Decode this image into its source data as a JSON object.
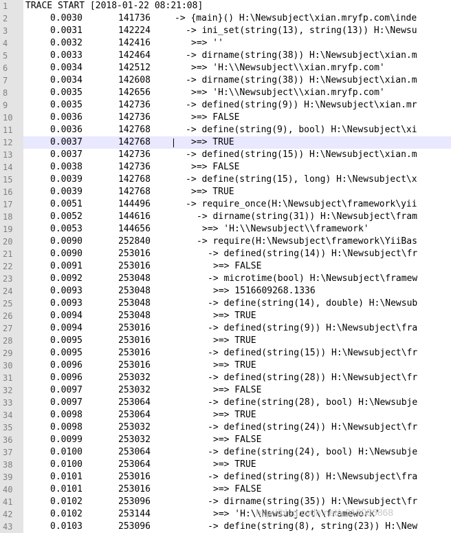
{
  "editor": {
    "lines": [
      {
        "n": "1",
        "full": "TRACE START [2018-01-22 08:21:08]"
      },
      {
        "n": "2",
        "t": "0.0030",
        "m": "141736",
        "c": "-> {main}() H:\\Newsubject\\xian.mryfp.com\\inde",
        "i": 0
      },
      {
        "n": "3",
        "t": "0.0031",
        "m": "142224",
        "c": "-> ini_set(string(13), string(13)) H:\\Newsu",
        "i": 2
      },
      {
        "n": "4",
        "t": "0.0032",
        "m": "142416",
        "c": ">=> ''",
        "i": 3
      },
      {
        "n": "5",
        "t": "0.0033",
        "m": "142464",
        "c": "-> dirname(string(38)) H:\\Newsubject\\xian.m",
        "i": 2
      },
      {
        "n": "6",
        "t": "0.0034",
        "m": "142512",
        "c": ">=> 'H:\\\\Newsubject\\\\xian.mryfp.com'",
        "i": 3
      },
      {
        "n": "7",
        "t": "0.0034",
        "m": "142608",
        "c": "-> dirname(string(38)) H:\\Newsubject\\xian.m",
        "i": 2
      },
      {
        "n": "8",
        "t": "0.0035",
        "m": "142656",
        "c": ">=> 'H:\\\\Newsubject\\\\xian.mryfp.com'",
        "i": 3
      },
      {
        "n": "9",
        "t": "0.0035",
        "m": "142736",
        "c": "-> defined(string(9)) H:\\Newsubject\\xian.mr",
        "i": 2
      },
      {
        "n": "10",
        "t": "0.0036",
        "m": "142736",
        "c": ">=> FALSE",
        "i": 3
      },
      {
        "n": "11",
        "t": "0.0036",
        "m": "142768",
        "c": "-> define(string(9), bool) H:\\Newsubject\\xi",
        "i": 2
      },
      {
        "n": "12",
        "t": "0.0037",
        "m": "142768",
        "c": ">=> TRUE",
        "i": 3,
        "current": true
      },
      {
        "n": "13",
        "t": "0.0037",
        "m": "142736",
        "c": "-> defined(string(15)) H:\\Newsubject\\xian.m",
        "i": 2
      },
      {
        "n": "14",
        "t": "0.0038",
        "m": "142736",
        "c": ">=> FALSE",
        "i": 3
      },
      {
        "n": "15",
        "t": "0.0039",
        "m": "142768",
        "c": "-> define(string(15), long) H:\\Newsubject\\x",
        "i": 2
      },
      {
        "n": "16",
        "t": "0.0039",
        "m": "142768",
        "c": ">=> TRUE",
        "i": 3
      },
      {
        "n": "17",
        "t": "0.0051",
        "m": "144496",
        "c": "-> require_once(H:\\Newsubject\\framework\\yii",
        "i": 2
      },
      {
        "n": "18",
        "t": "0.0052",
        "m": "144616",
        "c": "-> dirname(string(31)) H:\\Newsubject\\fram",
        "i": 4
      },
      {
        "n": "19",
        "t": "0.0053",
        "m": "144656",
        "c": ">=> 'H:\\\\Newsubject\\\\framework'",
        "i": 5
      },
      {
        "n": "20",
        "t": "0.0090",
        "m": "252840",
        "c": "-> require(H:\\Newsubject\\framework\\YiiBas",
        "i": 4
      },
      {
        "n": "21",
        "t": "0.0090",
        "m": "253016",
        "c": "-> defined(string(14)) H:\\Newsubject\\fr",
        "i": 6
      },
      {
        "n": "22",
        "t": "0.0091",
        "m": "253016",
        "c": ">=> FALSE",
        "i": 7
      },
      {
        "n": "23",
        "t": "0.0092",
        "m": "253048",
        "c": "-> microtime(bool) H:\\Newsubject\\framew",
        "i": 6
      },
      {
        "n": "24",
        "t": "0.0093",
        "m": "253048",
        "c": ">=> 1516609268.1336",
        "i": 7
      },
      {
        "n": "25",
        "t": "0.0093",
        "m": "253048",
        "c": "-> define(string(14), double) H:\\Newsub",
        "i": 6
      },
      {
        "n": "26",
        "t": "0.0094",
        "m": "253048",
        "c": ">=> TRUE",
        "i": 7
      },
      {
        "n": "27",
        "t": "0.0094",
        "m": "253016",
        "c": "-> defined(string(9)) H:\\Newsubject\\fra",
        "i": 6
      },
      {
        "n": "28",
        "t": "0.0095",
        "m": "253016",
        "c": ">=> TRUE",
        "i": 7
      },
      {
        "n": "29",
        "t": "0.0095",
        "m": "253016",
        "c": "-> defined(string(15)) H:\\Newsubject\\fr",
        "i": 6
      },
      {
        "n": "30",
        "t": "0.0096",
        "m": "253016",
        "c": ">=> TRUE",
        "i": 7
      },
      {
        "n": "31",
        "t": "0.0096",
        "m": "253032",
        "c": "-> defined(string(28)) H:\\Newsubject\\fr",
        "i": 6
      },
      {
        "n": "32",
        "t": "0.0097",
        "m": "253032",
        "c": ">=> FALSE",
        "i": 7
      },
      {
        "n": "33",
        "t": "0.0097",
        "m": "253064",
        "c": "-> define(string(28), bool) H:\\Newsubje",
        "i": 6
      },
      {
        "n": "34",
        "t": "0.0098",
        "m": "253064",
        "c": ">=> TRUE",
        "i": 7
      },
      {
        "n": "35",
        "t": "0.0098",
        "m": "253032",
        "c": "-> defined(string(24)) H:\\Newsubject\\fr",
        "i": 6
      },
      {
        "n": "36",
        "t": "0.0099",
        "m": "253032",
        "c": ">=> FALSE",
        "i": 7
      },
      {
        "n": "37",
        "t": "0.0100",
        "m": "253064",
        "c": "-> define(string(24), bool) H:\\Newsubje",
        "i": 6
      },
      {
        "n": "38",
        "t": "0.0100",
        "m": "253064",
        "c": ">=> TRUE",
        "i": 7
      },
      {
        "n": "39",
        "t": "0.0101",
        "m": "253016",
        "c": "-> defined(string(8)) H:\\Newsubject\\fra",
        "i": 6
      },
      {
        "n": "40",
        "t": "0.0101",
        "m": "253016",
        "c": ">=> FALSE",
        "i": 7
      },
      {
        "n": "41",
        "t": "0.0102",
        "m": "253096",
        "c": "-> dirname(string(35)) H:\\Newsubject\\fr",
        "i": 6
      },
      {
        "n": "42",
        "t": "0.0102",
        "m": "253144",
        "c": ">=> 'H:\\\\Newsubject\\\\framework'",
        "i": 7
      },
      {
        "n": "43",
        "t": "0.0103",
        "m": "253096",
        "c": "-> define(string(8), string(23)) H:\\New",
        "i": 6
      }
    ],
    "watermark": "http://blog.csdn.net/u010006868"
  }
}
